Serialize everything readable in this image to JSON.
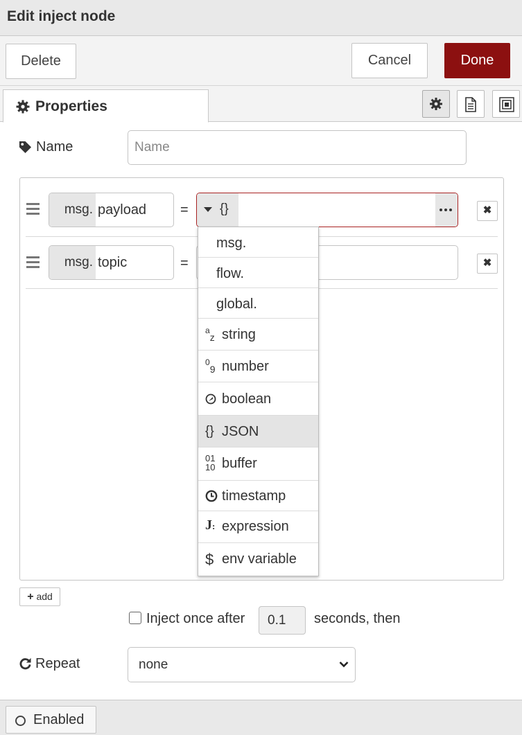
{
  "header": {
    "title": "Edit inject node"
  },
  "toolbar": {
    "delete_label": "Delete",
    "cancel_label": "Cancel",
    "done_label": "Done",
    "done_color": "#8c1010"
  },
  "tabs": {
    "properties_label": "Properties",
    "icons": [
      "gear-icon",
      "document-icon",
      "appearance-icon"
    ]
  },
  "name_field": {
    "label": "Name",
    "placeholder": "Name",
    "value": ""
  },
  "properties": [
    {
      "prefix": "msg.",
      "property": "payload",
      "equals": "=",
      "type_label": "{}",
      "value": ""
    },
    {
      "prefix": "msg.",
      "property": "topic",
      "equals": "=",
      "type_label": "",
      "value": ""
    }
  ],
  "type_menu": {
    "options": [
      {
        "icon": "",
        "label": "msg."
      },
      {
        "icon": "",
        "label": "flow."
      },
      {
        "icon": "az",
        "label": "string"
      },
      {
        "icon": "09",
        "label": "number"
      },
      {
        "icon": "boolean-icon",
        "label": "boolean"
      },
      {
        "icon": "{}",
        "label": "JSON",
        "selected": true
      },
      {
        "icon": "0110",
        "label": "buffer"
      },
      {
        "icon": "clock-icon",
        "label": "timestamp"
      },
      {
        "icon": "J:",
        "label": "expression"
      },
      {
        "icon": "$",
        "label": "env variable"
      }
    ],
    "global_label": "global."
  },
  "add_button": {
    "label": "add"
  },
  "inject_once": {
    "checked": false,
    "label_before": "Inject once after",
    "delay": "0.1",
    "label_after": "seconds, then"
  },
  "repeat": {
    "label": "Repeat",
    "selected": "none"
  },
  "footer": {
    "enabled_label": "Enabled"
  }
}
